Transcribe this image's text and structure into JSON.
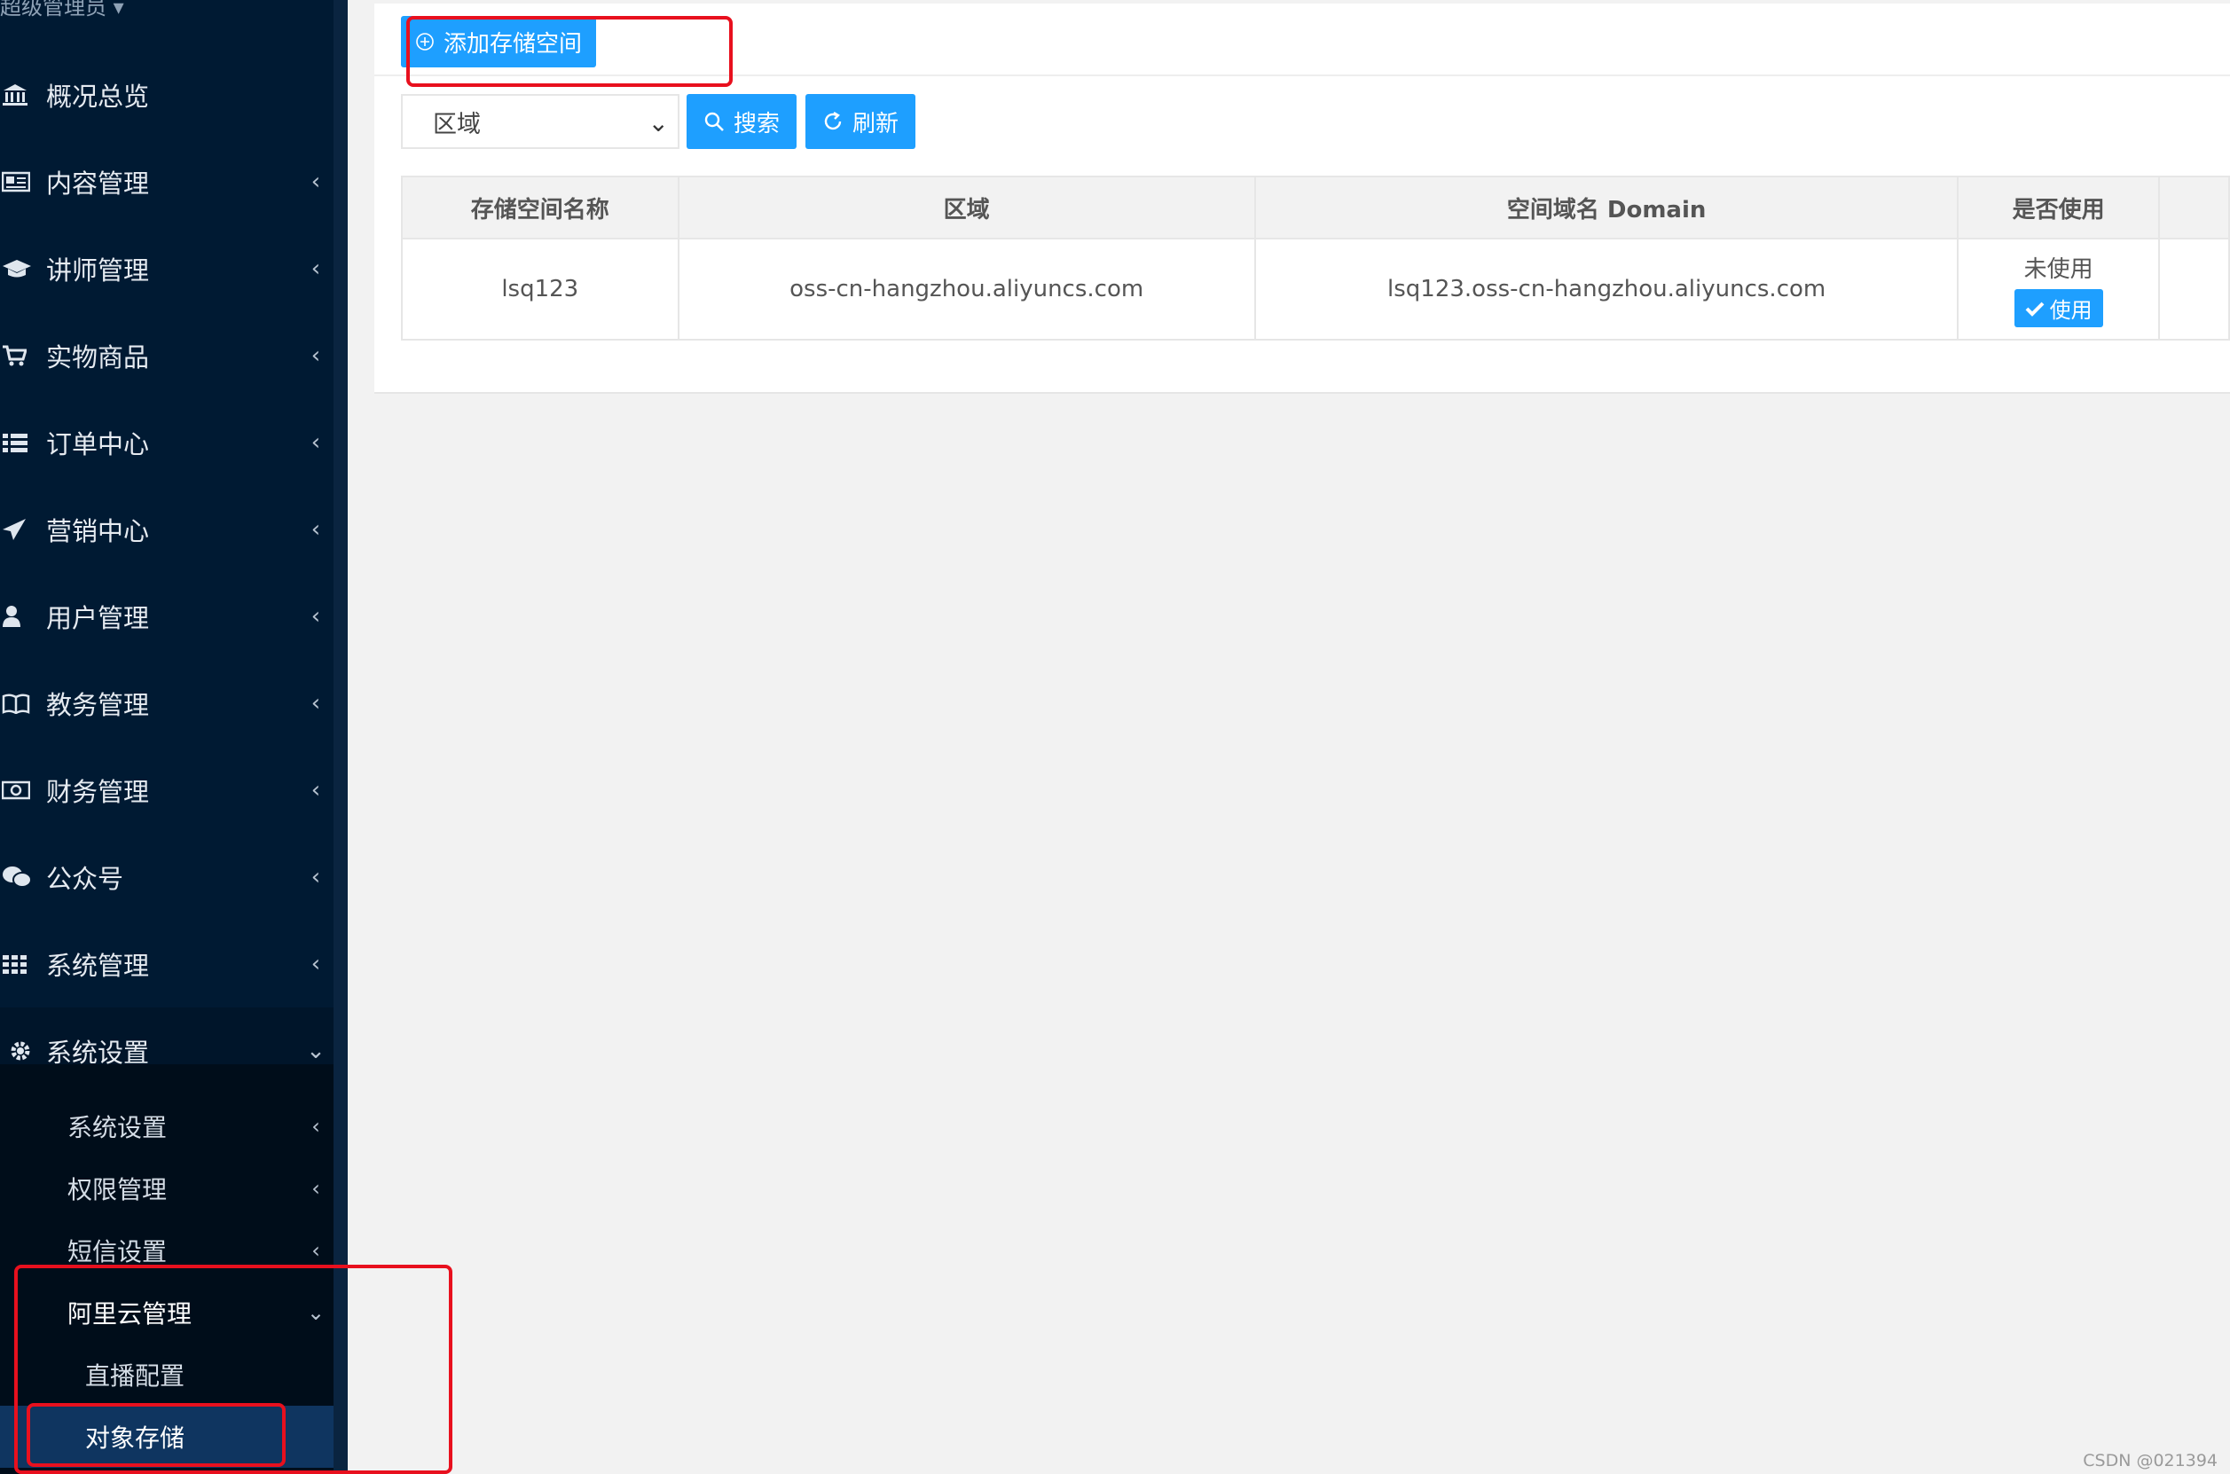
{
  "sidebar": {
    "admin_user": "超级管理员",
    "items": [
      {
        "label": "概况总览",
        "icon": "bank-icon"
      },
      {
        "label": "内容管理",
        "icon": "newspaper-icon"
      },
      {
        "label": "讲师管理",
        "icon": "graduation-cap-icon"
      },
      {
        "label": "实物商品",
        "icon": "cart-icon"
      },
      {
        "label": "订单中心",
        "icon": "list-icon"
      },
      {
        "label": "营销中心",
        "icon": "paper-plane-icon"
      },
      {
        "label": "用户管理",
        "icon": "user-icon"
      },
      {
        "label": "教务管理",
        "icon": "book-icon"
      },
      {
        "label": "财务管理",
        "icon": "money-icon"
      },
      {
        "label": "公众号",
        "icon": "wechat-icon"
      },
      {
        "label": "系统管理",
        "icon": "grid-icon"
      },
      {
        "label": "系统设置",
        "icon": "gear-icon"
      }
    ],
    "sub_items": [
      {
        "label": "系统设置"
      },
      {
        "label": "权限管理"
      },
      {
        "label": "短信设置"
      },
      {
        "label": "阿里云管理"
      },
      {
        "label": "直播配置"
      },
      {
        "label": "对象存储"
      }
    ]
  },
  "toolbar": {
    "add_label": "添加存储空间",
    "region_placeholder": "区域",
    "search_label": "搜索",
    "refresh_label": "刷新"
  },
  "table": {
    "headers": [
      "存储空间名称",
      "区域",
      "空间域名 Domain",
      "是否使用"
    ],
    "rows": [
      {
        "name": "lsq123",
        "region": "oss-cn-hangzhou.aliyuncs.com",
        "domain": "lsq123.oss-cn-hangzhou.aliyuncs.com",
        "status": "未使用",
        "action": "使用"
      }
    ]
  },
  "watermark": "CSDN @021394",
  "colors": {
    "sidebar_bg": "#001a33",
    "accent": "#1e9fff",
    "highlight": "#e8101e"
  }
}
